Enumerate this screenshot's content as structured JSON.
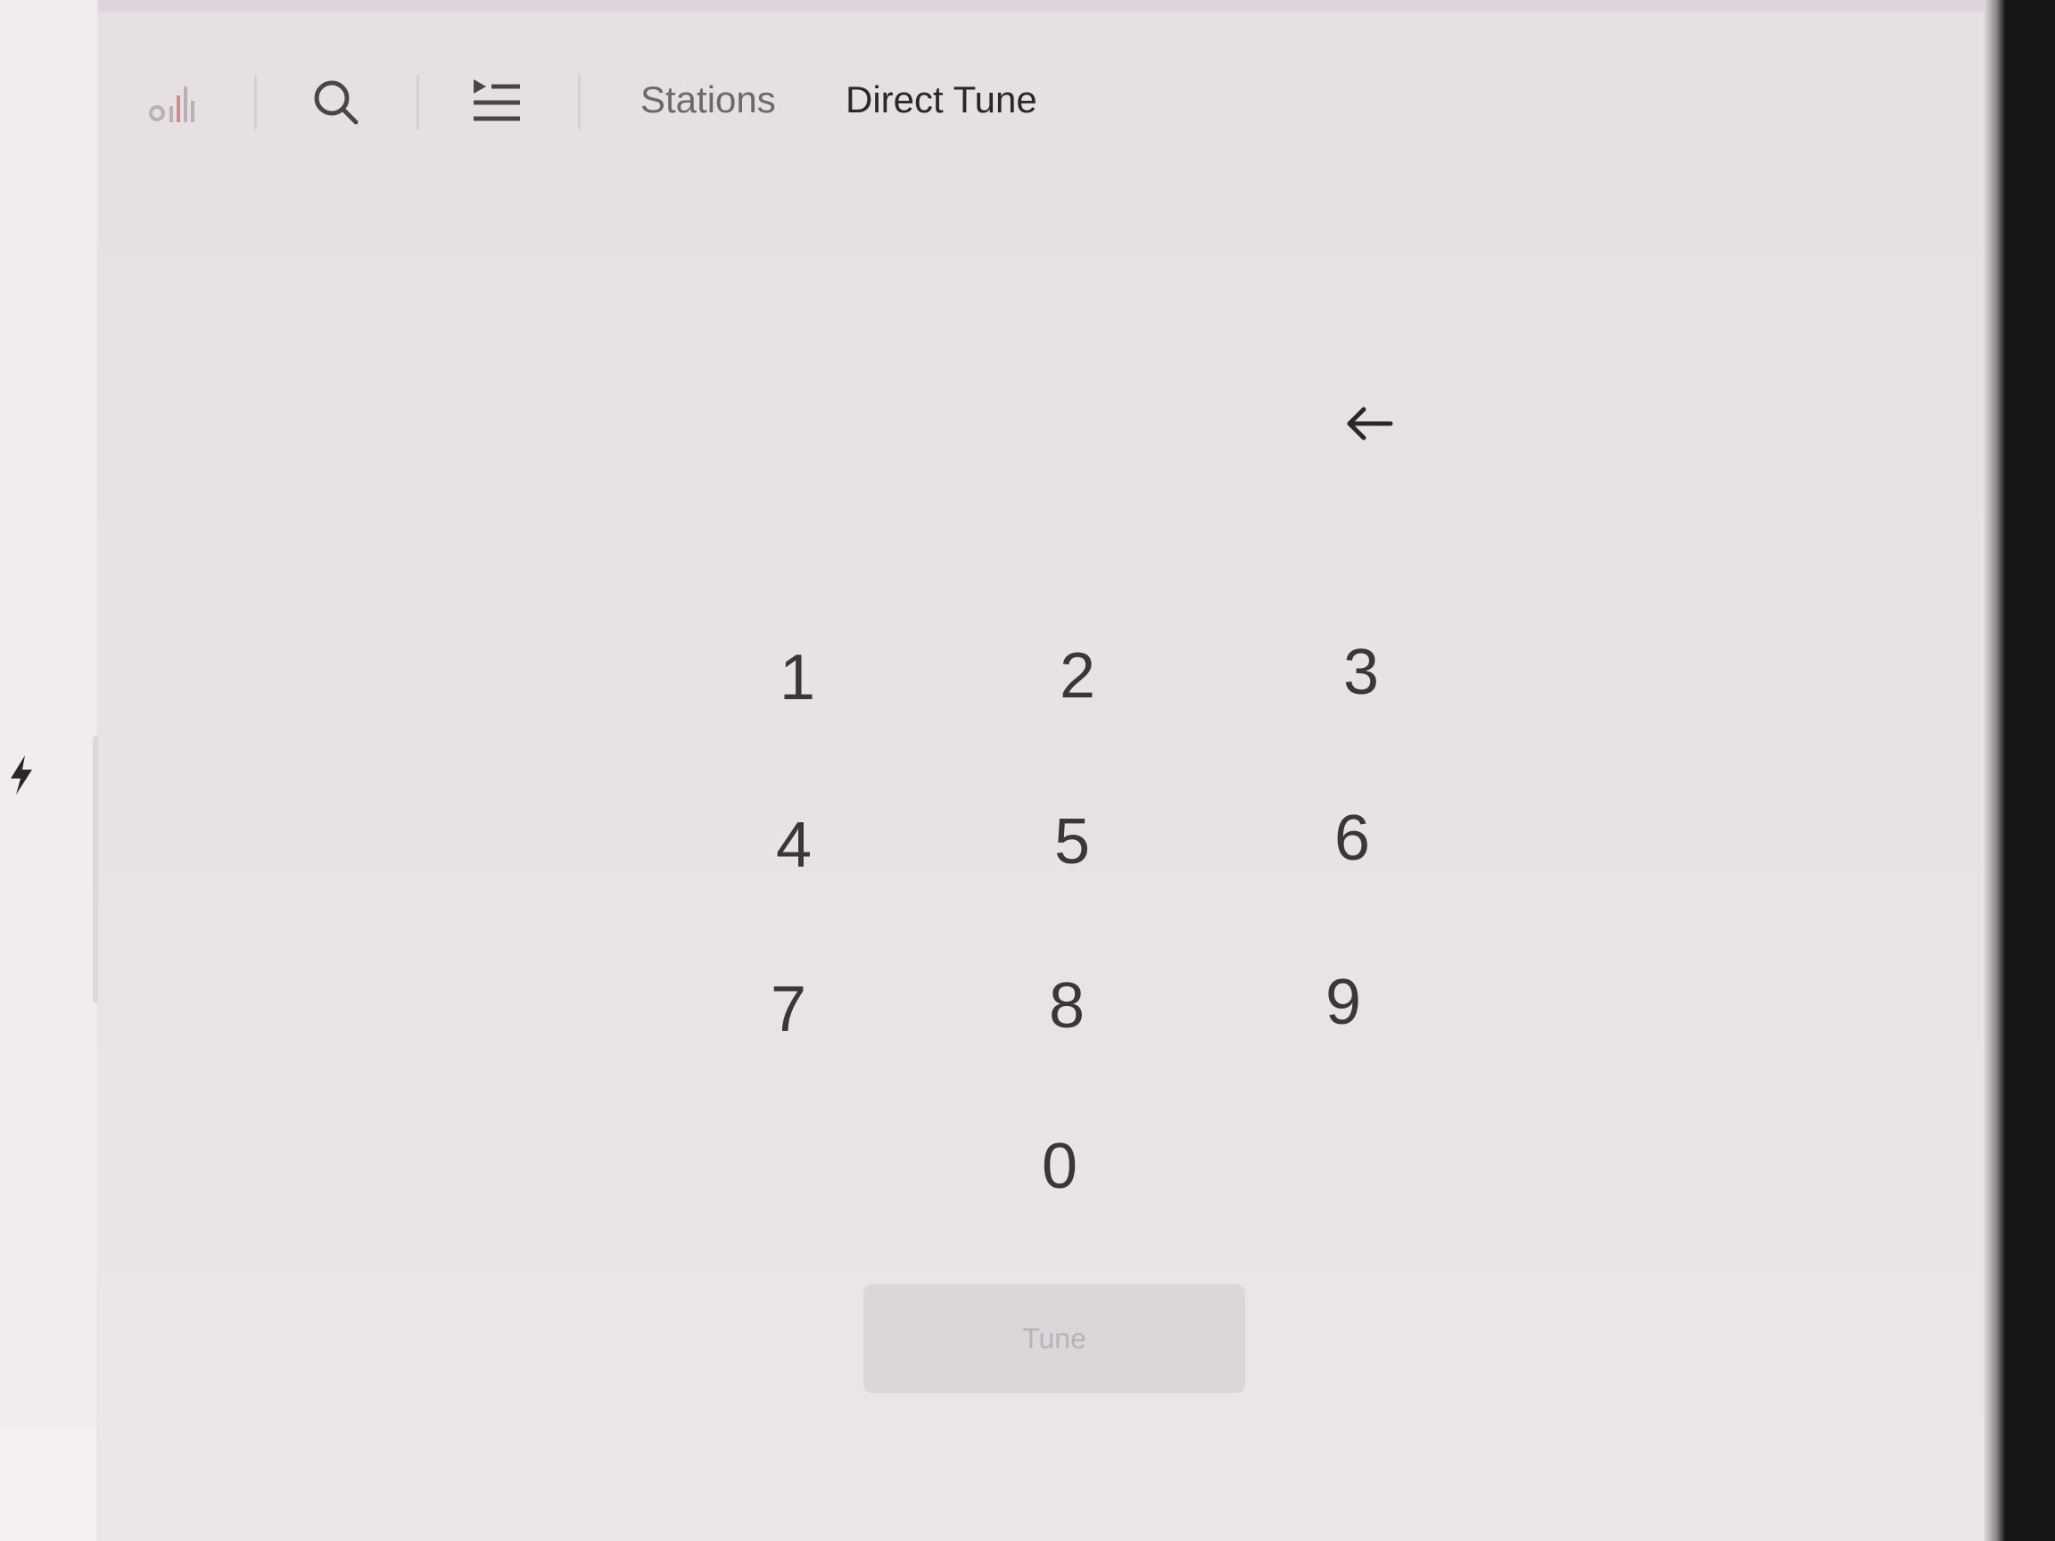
{
  "nav": {
    "tabs": [
      {
        "label": "Stations",
        "active": false
      },
      {
        "label": "Direct Tune",
        "active": true
      }
    ],
    "icons": [
      "equalizer-icon",
      "search-icon",
      "queue-icon"
    ]
  },
  "keypad": {
    "keys": [
      "1",
      "2",
      "3",
      "4",
      "5",
      "6",
      "7",
      "8",
      "9",
      "0"
    ]
  },
  "tune_button": {
    "label": "Tune",
    "enabled": false
  },
  "colors": {
    "background": "#ece6ea",
    "text_primary": "#2a2729",
    "text_secondary": "#6e686c",
    "button_disabled": "#dcd5da"
  }
}
